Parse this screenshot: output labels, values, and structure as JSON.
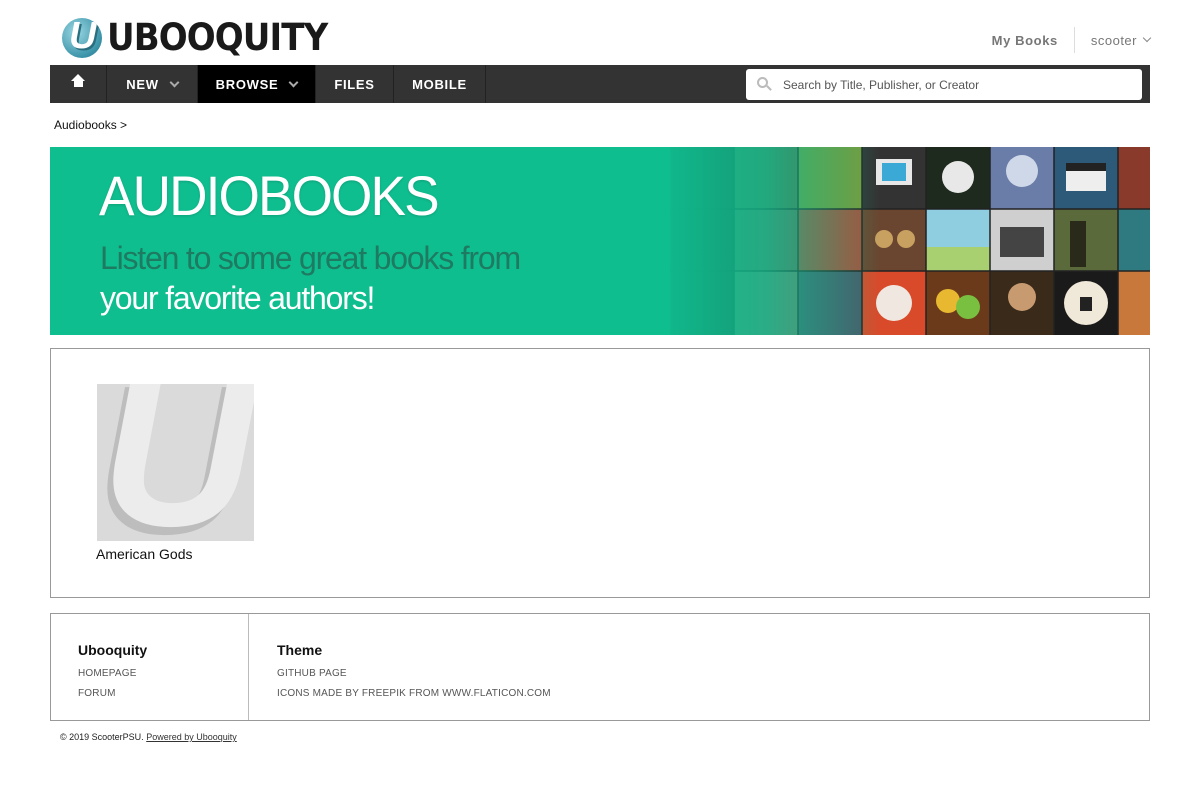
{
  "header": {
    "logo_letter": "U",
    "logo_text": "UBOOQUITY",
    "my_books_label": "My Books",
    "username": "scooter"
  },
  "nav": {
    "home_icon": "home-icon",
    "items": [
      {
        "label": "NEW",
        "has_dropdown": true
      },
      {
        "label": "BROWSE",
        "has_dropdown": true,
        "active": true
      },
      {
        "label": "FILES"
      },
      {
        "label": "MOBILE"
      }
    ],
    "search_placeholder": "Search by Title, Publisher, or Creator"
  },
  "breadcrumb": "Audiobooks >",
  "banner": {
    "title": "AUDIOBOOKS",
    "subtitle_line1": "Listen to some great books from",
    "subtitle_line2": "your favorite authors!",
    "bg_color": "#0fbe8f"
  },
  "books": [
    {
      "title": "American Gods",
      "cover_letter": "U"
    }
  ],
  "footer": {
    "col1": {
      "heading": "Ubooquity",
      "links": [
        "HOMEPAGE",
        "FORUM"
      ]
    },
    "col2": {
      "heading": "Theme",
      "links": [
        "GITHUB PAGE",
        "ICONS MADE BY FREEPIK FROM WWW.FLATICON.COM"
      ]
    }
  },
  "copyright": {
    "text": "© 2019 ScooterPSU.",
    "powered_by": "Powered by Ubooquity"
  }
}
